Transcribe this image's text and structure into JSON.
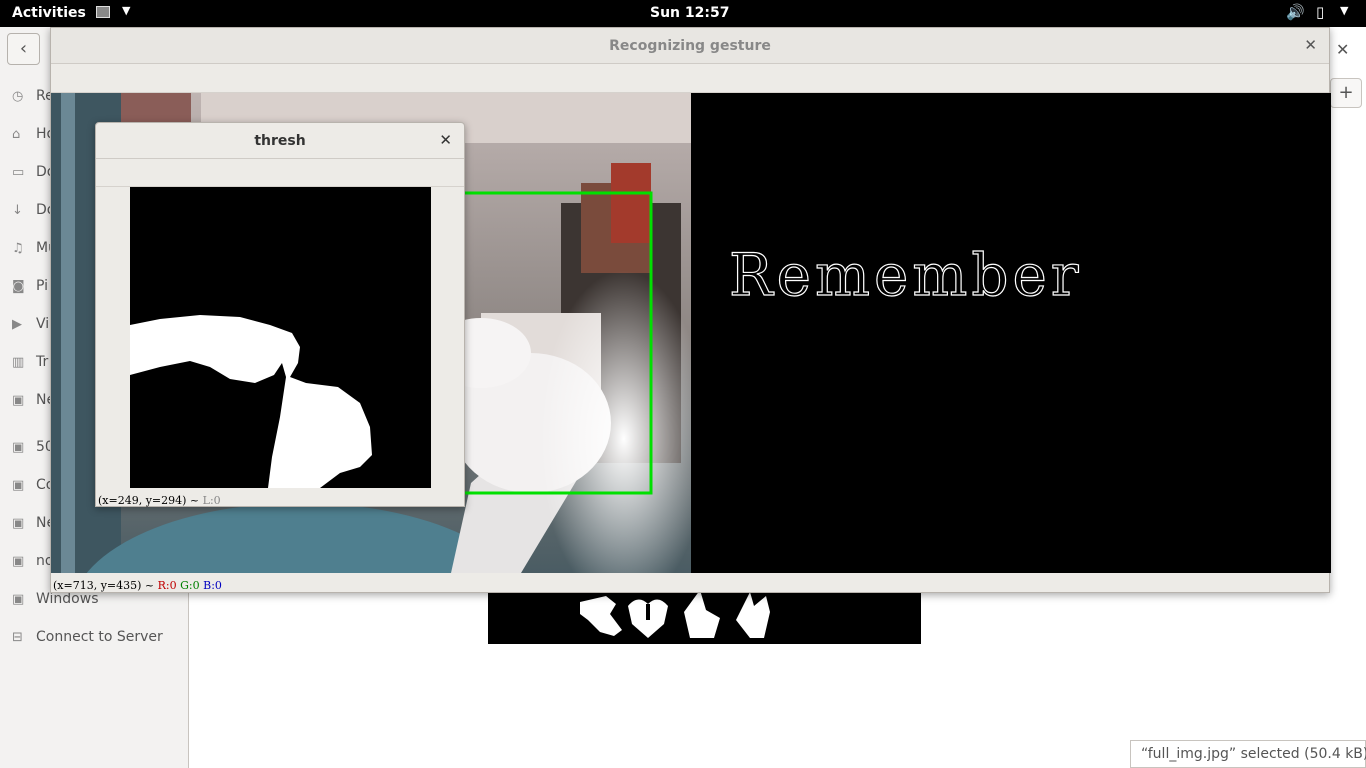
{
  "topbar": {
    "activities": "Activities",
    "clock": "Sun 12:57",
    "app_icon": "window-icon",
    "volume_icon": "volume-icon",
    "battery_icon": "battery-icon"
  },
  "file_manager": {
    "sidebar_items": [
      {
        "icon": "recent-icon",
        "label": "Re"
      },
      {
        "icon": "home-icon",
        "label": "Ho"
      },
      {
        "icon": "document-icon",
        "label": "Do"
      },
      {
        "icon": "download-icon",
        "label": "Do"
      },
      {
        "icon": "music-icon",
        "label": "Mu"
      },
      {
        "icon": "camera-icon",
        "label": "Pi"
      },
      {
        "icon": "video-icon",
        "label": "Vi"
      },
      {
        "icon": "trash-icon",
        "label": "Tr"
      },
      {
        "icon": "network-icon",
        "label": "Ne"
      },
      {
        "icon": "drive-icon",
        "label": "50"
      },
      {
        "icon": "drive-icon",
        "label": "Co"
      },
      {
        "icon": "drive-icon",
        "label": "Ne"
      },
      {
        "icon": "drive-icon",
        "label": "no"
      },
      {
        "icon": "drive-icon",
        "label": "Windows"
      },
      {
        "icon": "server-icon",
        "label": "Connect to Server"
      }
    ],
    "status": "“full_img.jpg” selected  (50.4 kB)"
  },
  "gesture_window": {
    "title": "Recognizing gesture",
    "recognized_text": "Remember",
    "status_coords": "(x=713, y=435) ~ ",
    "status_r": "R:0",
    "status_g": "G:0",
    "status_b": "B:0"
  },
  "thresh_window": {
    "title": "thresh",
    "status_coords": "(x=249, y=294) ~ ",
    "status_l": "L:0"
  },
  "colors": {
    "roi_box": "#00e000",
    "topbar_bg": "#000000"
  }
}
